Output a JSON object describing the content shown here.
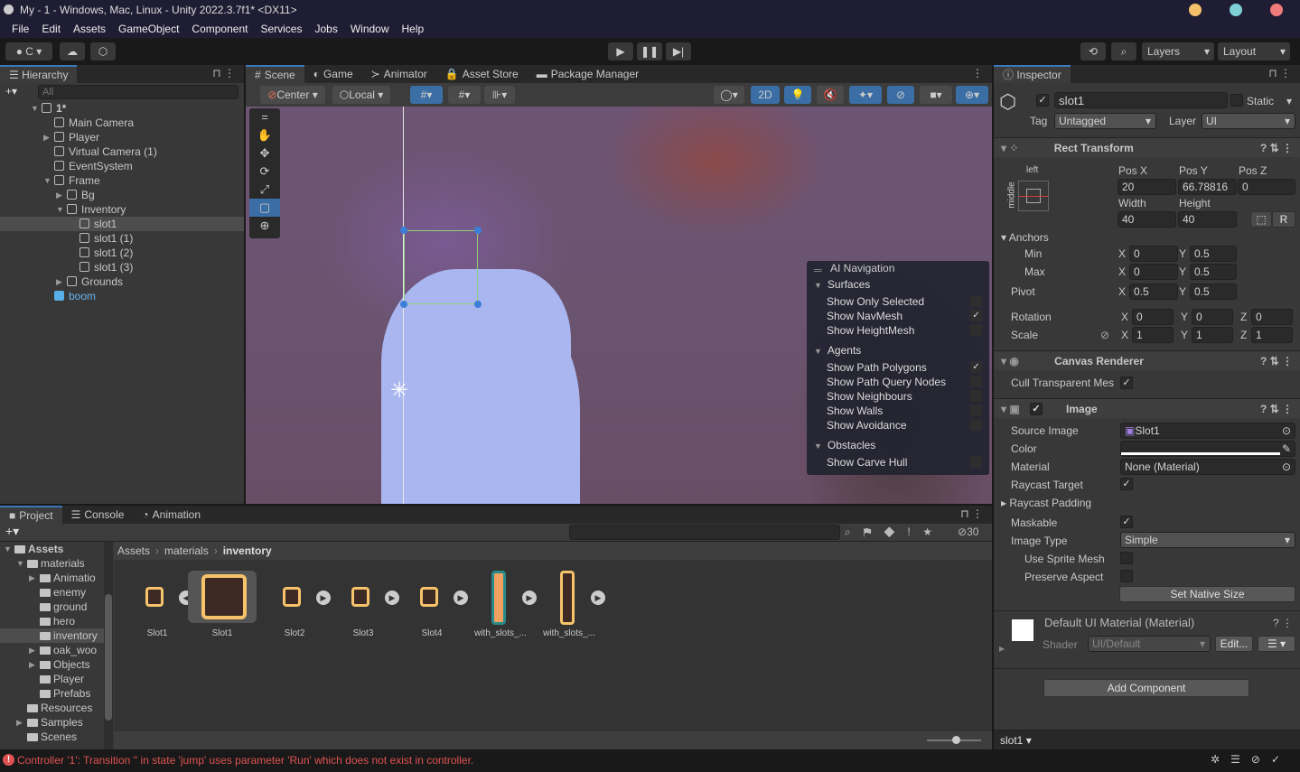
{
  "window": {
    "title": "My - 1 - Windows, Mac, Linux - Unity 2022.3.7f1* <DX11>",
    "dots": [
      "#f5c26b",
      "#7ecfd6",
      "#f07b7b"
    ]
  },
  "menu": [
    "File",
    "Edit",
    "Assets",
    "GameObject",
    "Component",
    "Services",
    "Jobs",
    "Window",
    "Help"
  ],
  "toolbar": {
    "account": "C",
    "layers": "Layers",
    "layout": "Layout"
  },
  "hierarchy": {
    "tab": "Hierarchy",
    "search_placeholder": "All",
    "items": [
      {
        "label": "1*",
        "depth": 0,
        "arrow": "down"
      },
      {
        "label": "Main Camera",
        "depth": 1,
        "arrow": ""
      },
      {
        "label": "Player",
        "depth": 1,
        "arrow": "right"
      },
      {
        "label": "Virtual Camera (1)",
        "depth": 1,
        "arrow": ""
      },
      {
        "label": "EventSystem",
        "depth": 1,
        "arrow": ""
      },
      {
        "label": "Frame",
        "depth": 1,
        "arrow": "down"
      },
      {
        "label": "Bg",
        "depth": 2,
        "arrow": "right"
      },
      {
        "label": "Inventory",
        "depth": 2,
        "arrow": "down"
      },
      {
        "label": "slot1",
        "depth": 3,
        "arrow": "",
        "selected": true
      },
      {
        "label": "slot1 (1)",
        "depth": 3,
        "arrow": ""
      },
      {
        "label": "slot1 (2)",
        "depth": 3,
        "arrow": ""
      },
      {
        "label": "slot1 (3)",
        "depth": 3,
        "arrow": ""
      },
      {
        "label": "Grounds",
        "depth": 2,
        "arrow": "right"
      },
      {
        "label": "boom",
        "depth": 1,
        "arrow": "",
        "prefab": true
      }
    ]
  },
  "scene": {
    "tabs": [
      "Scene",
      "Game",
      "Animator",
      "Asset Store",
      "Package Manager"
    ],
    "pivot": "Center",
    "space": "Local",
    "mode_2d": "2D"
  },
  "ai_nav": {
    "title": "AI Navigation",
    "sections": [
      {
        "name": "Surfaces",
        "items": [
          {
            "label": "Show Only Selected",
            "checked": false
          },
          {
            "label": "Show NavMesh",
            "checked": true
          },
          {
            "label": "Show HeightMesh",
            "checked": false
          }
        ]
      },
      {
        "name": "Agents",
        "items": [
          {
            "label": "Show Path Polygons",
            "checked": true
          },
          {
            "label": "Show Path Query Nodes",
            "checked": false
          },
          {
            "label": "Show Neighbours",
            "checked": false
          },
          {
            "label": "Show Walls",
            "checked": false
          },
          {
            "label": "Show Avoidance",
            "checked": false
          }
        ]
      },
      {
        "name": "Obstacles",
        "items": [
          {
            "label": "Show Carve Hull",
            "checked": false
          }
        ]
      }
    ]
  },
  "inspector": {
    "tab": "Inspector",
    "name": "slot1",
    "active": true,
    "static_label": "Static",
    "tag_label": "Tag",
    "tag": "Untagged",
    "layer_label": "Layer",
    "layer": "UI",
    "rect": {
      "title": "Rect Transform",
      "anchor_h": "left",
      "anchor_v": "middle",
      "posx_label": "Pos X",
      "posy_label": "Pos Y",
      "posz_label": "Pos Z",
      "posx": "20",
      "posy": "66.78816",
      "posz": "0",
      "width_label": "Width",
      "height_label": "Height",
      "width": "40",
      "height": "40",
      "r_btn": "R",
      "anchors": "Anchors",
      "min": "Min",
      "max": "Max",
      "pivot": "Pivot",
      "min_x": "0",
      "min_y": "0.5",
      "max_x": "0",
      "max_y": "0.5",
      "pivot_x": "0.5",
      "pivot_y": "0.5",
      "rotation": "Rotation",
      "scale": "Scale",
      "rot": [
        "0",
        "0",
        "0"
      ],
      "scl": [
        "1",
        "1",
        "1"
      ],
      "x": "X",
      "y": "Y",
      "z": "Z"
    },
    "canvas": {
      "title": "Canvas Renderer",
      "cull": "Cull Transparent Mes",
      "cull_checked": true
    },
    "image": {
      "title": "Image",
      "source_label": "Source Image",
      "source": "Slot1",
      "color_label": "Color",
      "color": "#ffffff",
      "material_label": "Material",
      "material": "None (Material)",
      "raycast_target": "Raycast Target",
      "raycast_padding": "Raycast Padding",
      "maskable": "Maskable",
      "image_type_label": "Image Type",
      "image_type": "Simple",
      "use_sprite_mesh": "Use Sprite Mesh",
      "preserve_aspect": "Preserve Aspect",
      "set_native": "Set Native Size"
    },
    "material": {
      "title": "Default UI Material (Material)",
      "shader_label": "Shader",
      "shader": "UI/Default",
      "edit": "Edit..."
    },
    "add_component": "Add Component",
    "footer": "slot1"
  },
  "project": {
    "tabs": [
      "Project",
      "Console",
      "Animation"
    ],
    "count": "30",
    "tree": [
      {
        "label": "Assets",
        "depth": 0,
        "arrow": "down",
        "bold": true
      },
      {
        "label": "materials",
        "depth": 1,
        "arrow": "down"
      },
      {
        "label": "Animatio",
        "depth": 2,
        "arrow": "right"
      },
      {
        "label": "enemy",
        "depth": 2,
        "arrow": ""
      },
      {
        "label": "ground",
        "depth": 2,
        "arrow": ""
      },
      {
        "label": "hero",
        "depth": 2,
        "arrow": ""
      },
      {
        "label": "inventory",
        "depth": 2,
        "arrow": "",
        "selected": true
      },
      {
        "label": "oak_woo",
        "depth": 2,
        "arrow": "right"
      },
      {
        "label": "Objects",
        "depth": 2,
        "arrow": "right"
      },
      {
        "label": "Player",
        "depth": 2,
        "arrow": ""
      },
      {
        "label": "Prefabs",
        "depth": 2,
        "arrow": ""
      },
      {
        "label": "Resources",
        "depth": 1,
        "arrow": ""
      },
      {
        "label": "Samples",
        "depth": 1,
        "arrow": "right"
      },
      {
        "label": "Scenes",
        "depth": 1,
        "arrow": ""
      }
    ],
    "breadcrumb": [
      "Assets",
      "materials",
      "inventory"
    ],
    "assets": [
      {
        "label": "Slot1",
        "kind": "slot"
      },
      {
        "label": "Slot1",
        "kind": "big"
      },
      {
        "label": "Slot2",
        "kind": "slot"
      },
      {
        "label": "Slot3",
        "kind": "slot"
      },
      {
        "label": "Slot4",
        "kind": "slot"
      },
      {
        "label": "with_slots_...",
        "kind": "strip-filled"
      },
      {
        "label": "with_slots_...",
        "kind": "strip"
      }
    ]
  },
  "status": {
    "message": "Controller '1': Transition '' in state 'jump' uses parameter 'Run' which does not exist in controller.",
    "color": "#e05252"
  }
}
